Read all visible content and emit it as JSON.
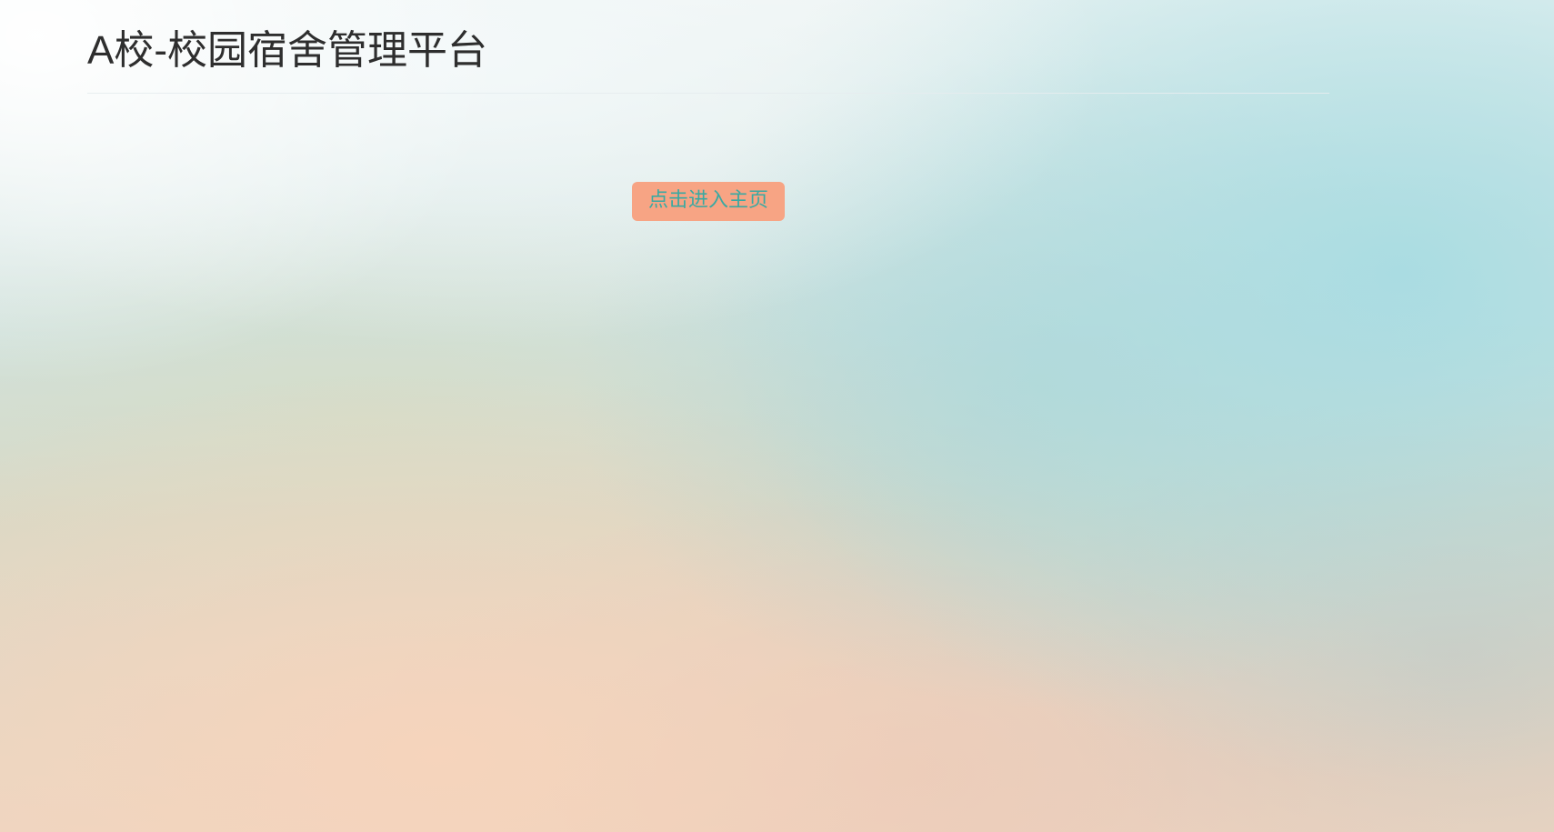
{
  "header": {
    "title": "A校-校园宿舍管理平台"
  },
  "main": {
    "enter_button_label": "点击进入主页"
  },
  "colors": {
    "button_background": "#f7a484",
    "button_text": "#3aa9a2",
    "title_text": "#2e2e2e"
  }
}
